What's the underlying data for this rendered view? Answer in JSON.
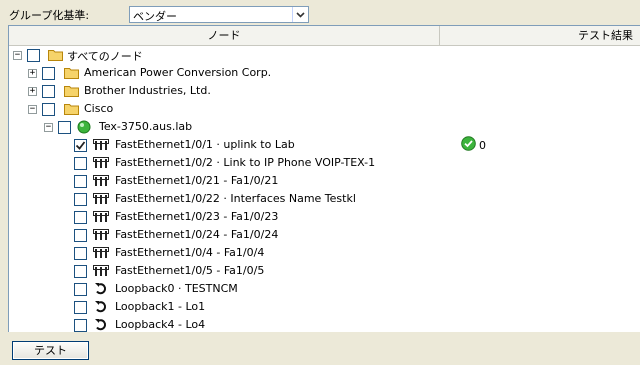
{
  "toolbar": {
    "group_label": "グループ化基準:",
    "group_value": "ベンダー"
  },
  "columns": {
    "node": "ノード",
    "result": "テスト結果"
  },
  "tree": {
    "root": {
      "label": "すべてのノード",
      "expander": "−",
      "checked": false
    },
    "vendor_apc": {
      "label": "American Power Conversion Corp.",
      "expander": "+",
      "checked": false
    },
    "vendor_brother": {
      "label": "Brother Industries, Ltd.",
      "expander": "+",
      "checked": false
    },
    "vendor_cisco": {
      "label": "Cisco",
      "expander": "−",
      "checked": false
    },
    "node_tex": {
      "label": "Tex-3750.aus.lab",
      "expander": "−",
      "checked": false
    },
    "interfaces": [
      {
        "label": "FastEthernet1/0/1 · uplink to Lab",
        "icon": "network-port-icon",
        "checked": true,
        "result": "0"
      },
      {
        "label": "FastEthernet1/0/2 · Link to IP Phone VOIP-TEX-1",
        "icon": "network-port-icon",
        "checked": false
      },
      {
        "label": "FastEthernet1/0/21 - Fa1/0/21",
        "icon": "network-port-icon",
        "checked": false
      },
      {
        "label": "FastEthernet1/0/22 · Interfaces Name Testkl",
        "icon": "network-port-icon",
        "checked": false
      },
      {
        "label": "FastEthernet1/0/23 - Fa1/0/23",
        "icon": "network-port-icon",
        "checked": false
      },
      {
        "label": "FastEthernet1/0/24 - Fa1/0/24",
        "icon": "network-port-icon",
        "checked": false
      },
      {
        "label": "FastEthernet1/0/4 - Fa1/0/4",
        "icon": "network-port-icon",
        "checked": false
      },
      {
        "label": "FastEthernet1/0/5 - Fa1/0/5",
        "icon": "network-port-icon",
        "checked": false
      },
      {
        "label": "Loopback0 · TESTNCM",
        "icon": "loopback-icon",
        "checked": false
      },
      {
        "label": "Loopback1 - Lo1",
        "icon": "loopback-icon",
        "checked": false
      },
      {
        "label": "Loopback4 - Lo4",
        "icon": "loopback-icon",
        "checked": false
      }
    ]
  },
  "buttons": {
    "test": "テスト"
  },
  "colors": {
    "folder": "#e8b93a",
    "status_ok": "#3cb43c",
    "window_bg": "#ece9d8"
  }
}
